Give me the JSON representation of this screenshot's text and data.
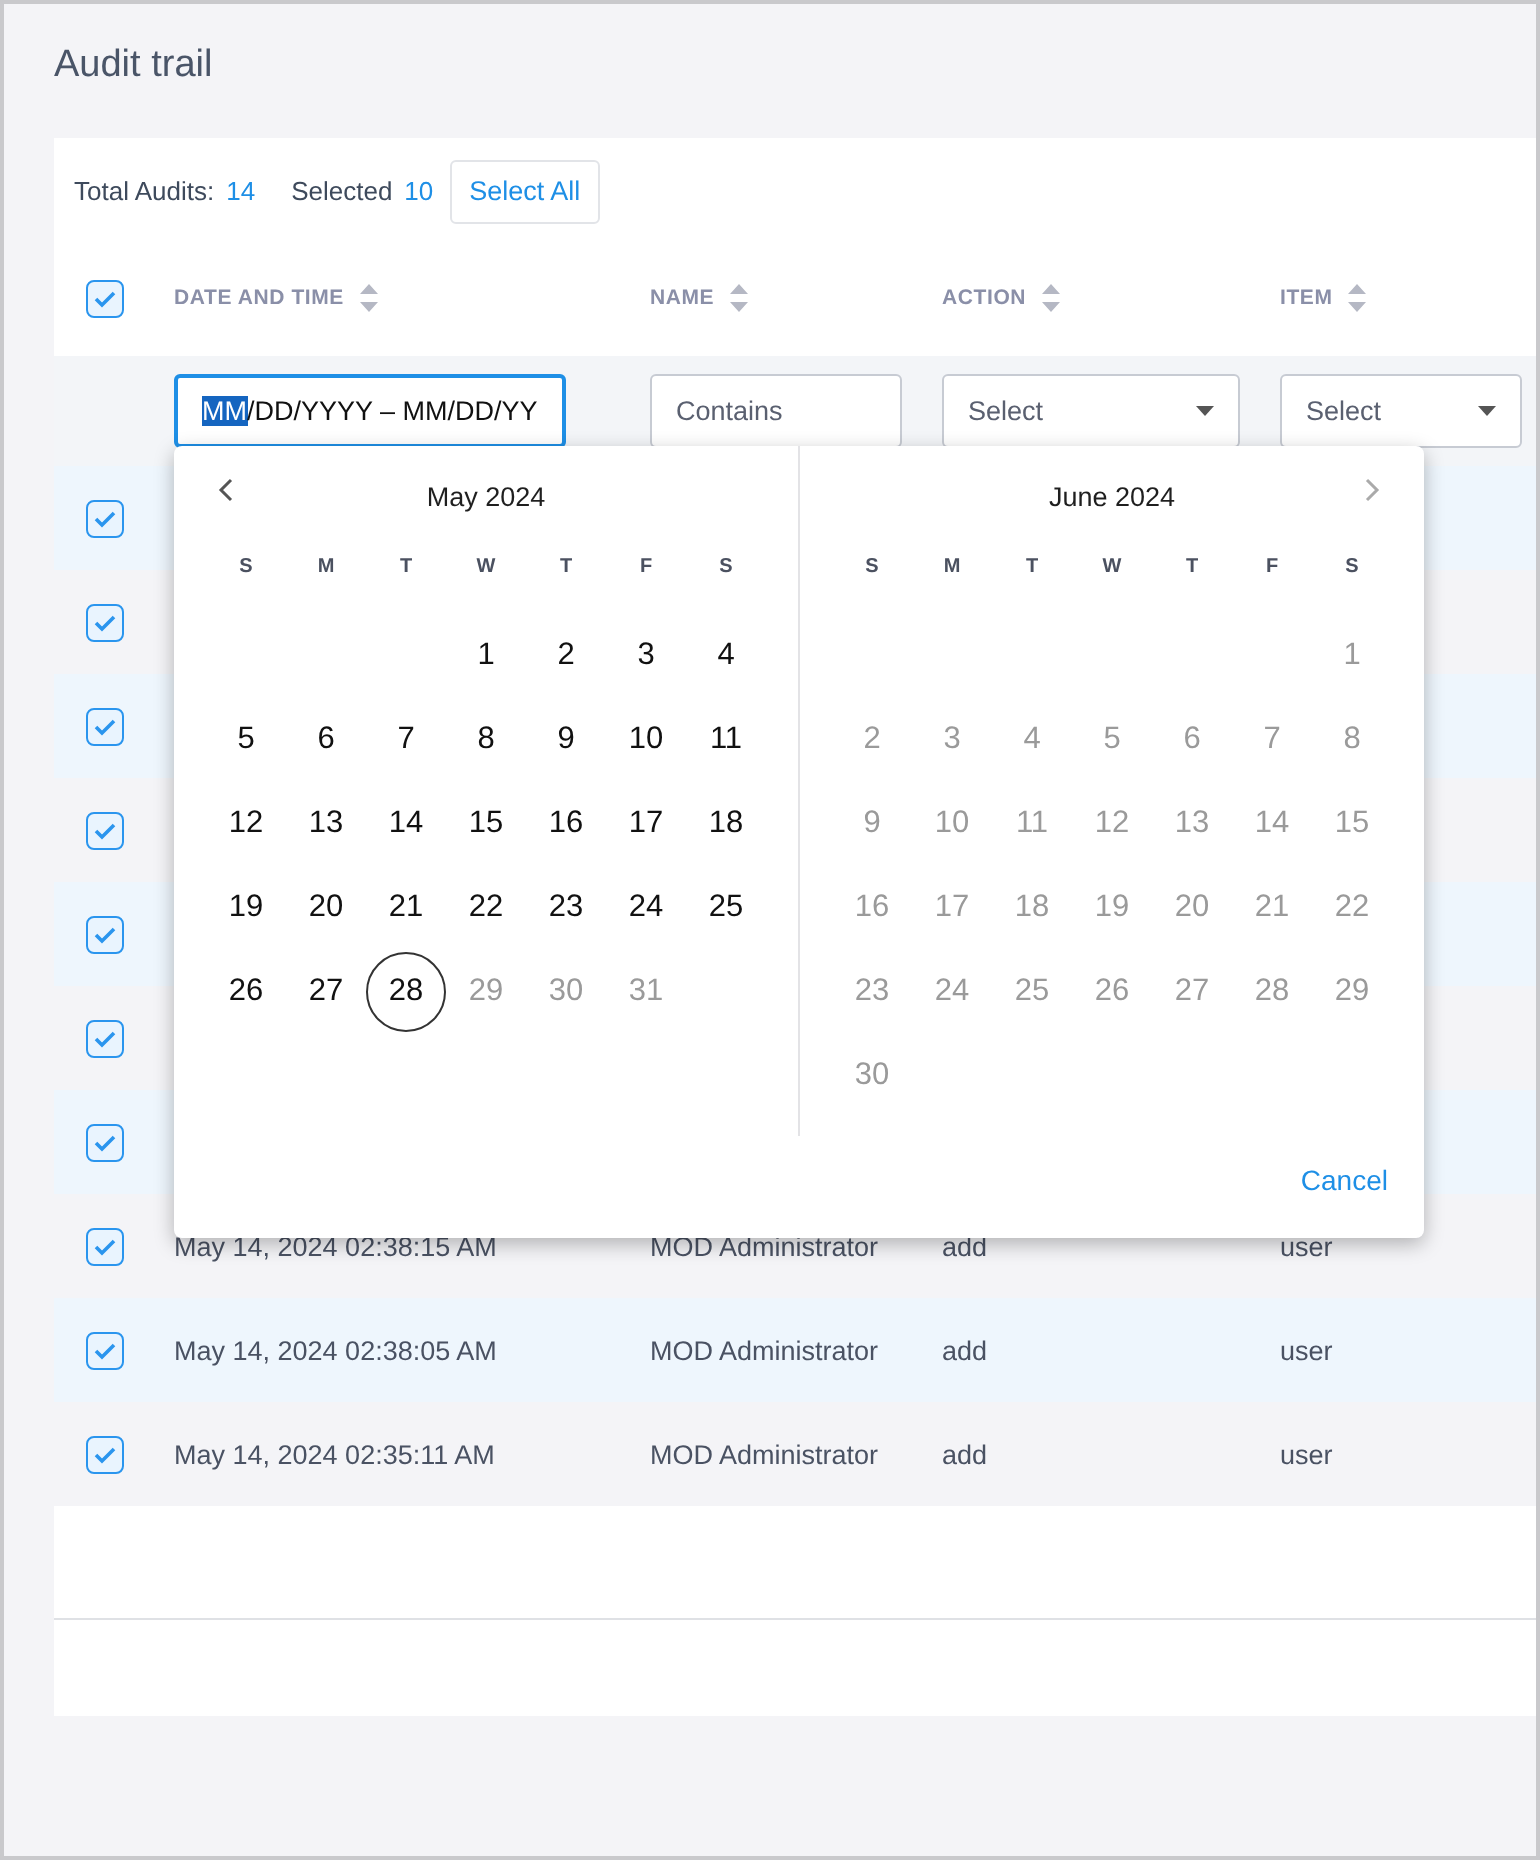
{
  "page": {
    "title": "Audit trail"
  },
  "summary": {
    "total_label": "Total Audits:",
    "total_value": "14",
    "selected_label": "Selected",
    "selected_value": "10",
    "select_all": "Select All"
  },
  "table": {
    "header_checked": true,
    "columns": [
      {
        "label": "DATE AND TIME"
      },
      {
        "label": "NAME"
      },
      {
        "label": "ACTION"
      },
      {
        "label": "ITEM"
      }
    ],
    "filters": {
      "date": {
        "highlighted": "MM",
        "rest": "/DD/YYYY – MM/DD/YY"
      },
      "name": {
        "placeholder": "Contains"
      },
      "action": {
        "value": "Select"
      },
      "item": {
        "value": "Select"
      }
    },
    "rows": [
      {
        "checked": true
      },
      {
        "checked": true
      },
      {
        "checked": true
      },
      {
        "checked": true
      },
      {
        "checked": true
      },
      {
        "checked": true
      },
      {
        "checked": true
      },
      {
        "checked": true,
        "date": "May 14, 2024 02:38:15 AM",
        "name": "MOD Administrator",
        "action": "add",
        "item": "user"
      },
      {
        "checked": true,
        "date": "May 14, 2024 02:38:05 AM",
        "name": "MOD Administrator",
        "action": "add",
        "item": "user"
      },
      {
        "checked": true,
        "date": "May 14, 2024 02:35:11 AM",
        "name": "MOD Administrator",
        "action": "add",
        "item": "user"
      }
    ]
  },
  "calendar": {
    "cancel": "Cancel",
    "months": [
      {
        "title": "May 2024",
        "has_prev": true,
        "has_next": false,
        "weekdays": [
          "S",
          "M",
          "T",
          "W",
          "T",
          "F",
          "S"
        ],
        "weeks": [
          [
            {
              "kind": "blank"
            },
            {
              "kind": "blank"
            },
            {
              "kind": "blank"
            },
            {
              "kind": "day",
              "label": "1",
              "muted": false,
              "selected": false
            },
            {
              "kind": "day",
              "label": "2",
              "muted": false,
              "selected": false
            },
            {
              "kind": "day",
              "label": "3",
              "muted": false,
              "selected": false
            },
            {
              "kind": "day",
              "label": "4",
              "muted": false,
              "selected": false
            }
          ],
          [
            {
              "kind": "day",
              "label": "5",
              "muted": false,
              "selected": false
            },
            {
              "kind": "day",
              "label": "6",
              "muted": false,
              "selected": false
            },
            {
              "kind": "day",
              "label": "7",
              "muted": false,
              "selected": false
            },
            {
              "kind": "day",
              "label": "8",
              "muted": false,
              "selected": false
            },
            {
              "kind": "day",
              "label": "9",
              "muted": false,
              "selected": false
            },
            {
              "kind": "day",
              "label": "10",
              "muted": false,
              "selected": false
            },
            {
              "kind": "day",
              "label": "11",
              "muted": false,
              "selected": false
            }
          ],
          [
            {
              "kind": "day",
              "label": "12",
              "muted": false,
              "selected": false
            },
            {
              "kind": "day",
              "label": "13",
              "muted": false,
              "selected": false
            },
            {
              "kind": "day",
              "label": "14",
              "muted": false,
              "selected": false
            },
            {
              "kind": "day",
              "label": "15",
              "muted": false,
              "selected": false
            },
            {
              "kind": "day",
              "label": "16",
              "muted": false,
              "selected": false
            },
            {
              "kind": "day",
              "label": "17",
              "muted": false,
              "selected": false
            },
            {
              "kind": "day",
              "label": "18",
              "muted": false,
              "selected": false
            }
          ],
          [
            {
              "kind": "day",
              "label": "19",
              "muted": false,
              "selected": false
            },
            {
              "kind": "day",
              "label": "20",
              "muted": false,
              "selected": false
            },
            {
              "kind": "day",
              "label": "21",
              "muted": false,
              "selected": false
            },
            {
              "kind": "day",
              "label": "22",
              "muted": false,
              "selected": false
            },
            {
              "kind": "day",
              "label": "23",
              "muted": false,
              "selected": false
            },
            {
              "kind": "day",
              "label": "24",
              "muted": false,
              "selected": false
            },
            {
              "kind": "day",
              "label": "25",
              "muted": false,
              "selected": false
            }
          ],
          [
            {
              "kind": "day",
              "label": "26",
              "muted": false,
              "selected": false
            },
            {
              "kind": "day",
              "label": "27",
              "muted": false,
              "selected": false
            },
            {
              "kind": "day",
              "label": "28",
              "muted": false,
              "selected": true
            },
            {
              "kind": "day",
              "label": "29",
              "muted": true,
              "selected": false
            },
            {
              "kind": "day",
              "label": "30",
              "muted": true,
              "selected": false
            },
            {
              "kind": "day",
              "label": "31",
              "muted": true,
              "selected": false
            },
            {
              "kind": "blank"
            }
          ]
        ]
      },
      {
        "title": "June 2024",
        "has_prev": false,
        "has_next": true,
        "weekdays": [
          "S",
          "M",
          "T",
          "W",
          "T",
          "F",
          "S"
        ],
        "weeks": [
          [
            {
              "kind": "blank"
            },
            {
              "kind": "blank"
            },
            {
              "kind": "blank"
            },
            {
              "kind": "blank"
            },
            {
              "kind": "blank"
            },
            {
              "kind": "blank"
            },
            {
              "kind": "day",
              "label": "1",
              "muted": true,
              "selected": false
            }
          ],
          [
            {
              "kind": "day",
              "label": "2",
              "muted": true,
              "selected": false
            },
            {
              "kind": "day",
              "label": "3",
              "muted": true,
              "selected": false
            },
            {
              "kind": "day",
              "label": "4",
              "muted": true,
              "selected": false
            },
            {
              "kind": "day",
              "label": "5",
              "muted": true,
              "selected": false
            },
            {
              "kind": "day",
              "label": "6",
              "muted": true,
              "selected": false
            },
            {
              "kind": "day",
              "label": "7",
              "muted": true,
              "selected": false
            },
            {
              "kind": "day",
              "label": "8",
              "muted": true,
              "selected": false
            }
          ],
          [
            {
              "kind": "day",
              "label": "9",
              "muted": true,
              "selected": false
            },
            {
              "kind": "day",
              "label": "10",
              "muted": true,
              "selected": false
            },
            {
              "kind": "day",
              "label": "11",
              "muted": true,
              "selected": false
            },
            {
              "kind": "day",
              "label": "12",
              "muted": true,
              "selected": false
            },
            {
              "kind": "day",
              "label": "13",
              "muted": true,
              "selected": false
            },
            {
              "kind": "day",
              "label": "14",
              "muted": true,
              "selected": false
            },
            {
              "kind": "day",
              "label": "15",
              "muted": true,
              "selected": false
            }
          ],
          [
            {
              "kind": "day",
              "label": "16",
              "muted": true,
              "selected": false
            },
            {
              "kind": "day",
              "label": "17",
              "muted": true,
              "selected": false
            },
            {
              "kind": "day",
              "label": "18",
              "muted": true,
              "selected": false
            },
            {
              "kind": "day",
              "label": "19",
              "muted": true,
              "selected": false
            },
            {
              "kind": "day",
              "label": "20",
              "muted": true,
              "selected": false
            },
            {
              "kind": "day",
              "label": "21",
              "muted": true,
              "selected": false
            },
            {
              "kind": "day",
              "label": "22",
              "muted": true,
              "selected": false
            }
          ],
          [
            {
              "kind": "day",
              "label": "23",
              "muted": true,
              "selected": false
            },
            {
              "kind": "day",
              "label": "24",
              "muted": true,
              "selected": false
            },
            {
              "kind": "day",
              "label": "25",
              "muted": true,
              "selected": false
            },
            {
              "kind": "day",
              "label": "26",
              "muted": true,
              "selected": false
            },
            {
              "kind": "day",
              "label": "27",
              "muted": true,
              "selected": false
            },
            {
              "kind": "day",
              "label": "28",
              "muted": true,
              "selected": false
            },
            {
              "kind": "day",
              "label": "29",
              "muted": true,
              "selected": false
            }
          ],
          [
            {
              "kind": "day",
              "label": "30",
              "muted": true,
              "selected": false
            },
            {
              "kind": "blank"
            },
            {
              "kind": "blank"
            },
            {
              "kind": "blank"
            },
            {
              "kind": "blank"
            },
            {
              "kind": "blank"
            },
            {
              "kind": "blank"
            }
          ]
        ]
      }
    ]
  }
}
